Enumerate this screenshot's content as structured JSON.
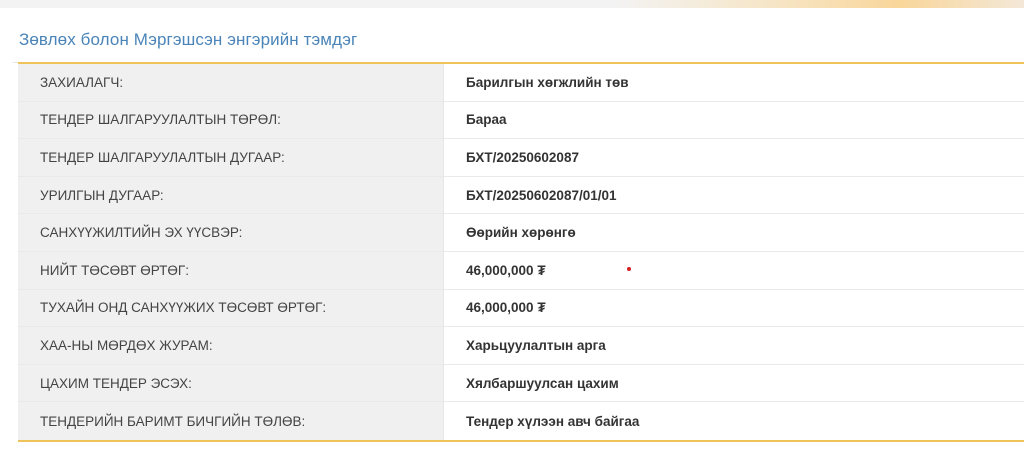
{
  "panel": {
    "title": "Зөвлөх болон Мэргэшсэн энгэрийн тэмдэг"
  },
  "rows": [
    {
      "label": "ЗАХИАЛАГЧ:",
      "value": "Барилгын хөгжлийн төв"
    },
    {
      "label": "ТЕНДЕР ШАЛГАРУУЛАЛТЫН ТӨРӨЛ:",
      "value": "Бараа"
    },
    {
      "label": "ТЕНДЕР ШАЛГАРУУЛАЛТЫН ДУГААР:",
      "value": "БХТ/20250602087"
    },
    {
      "label": "УРИЛГЫН ДУГААР:",
      "value": "БХТ/20250602087/01/01"
    },
    {
      "label": "САНХҮҮЖИЛТИЙН ЭХ ҮҮСВЭР:",
      "value": "Өөрийн хөрөнгө"
    },
    {
      "label": "НИЙТ ТӨСӨВТ ӨРТӨГ:",
      "value": "46,000,000 ₮"
    },
    {
      "label": "ТУХАЙН ОНД САНХҮҮЖИХ ТӨСӨВТ ӨРТӨГ:",
      "value": "46,000,000 ₮"
    },
    {
      "label": "ХАА-НЫ МӨРДӨХ ЖУРАМ:",
      "value": "Харьцуулалтын арга"
    },
    {
      "label": "ЦАХИМ ТЕНДЕР ЭСЭХ:",
      "value": "Хялбаршуулсан цахим"
    },
    {
      "label": "ТЕНДЕРИЙН БАРИМТ БИЧГИЙН ТӨЛӨВ:",
      "value": "Тендер хүлээн авч байгаа"
    }
  ],
  "colors": {
    "title": "#4a84b8",
    "accent_border": "#f0c35a",
    "label_bg": "#f0f0f0",
    "marker": "#d42020"
  }
}
